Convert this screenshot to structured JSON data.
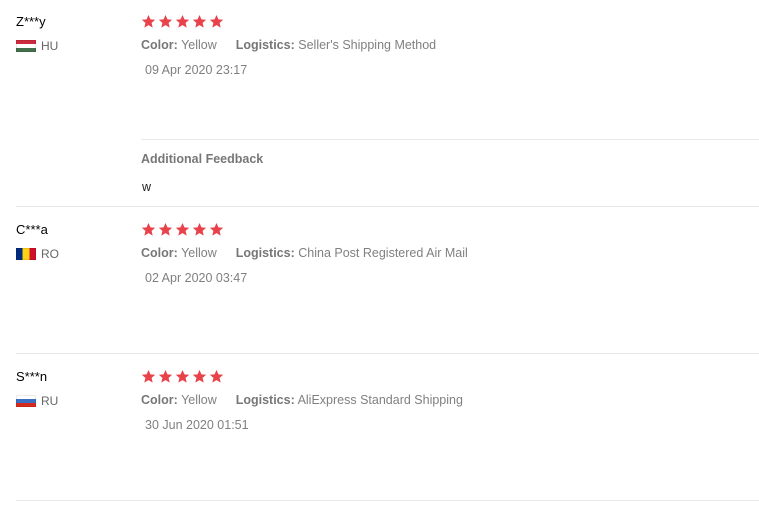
{
  "labels": {
    "color": "Color:",
    "logistics": "Logistics:",
    "additional_feedback": "Additional Feedback"
  },
  "colors": {
    "star": "#e8424a",
    "text_muted": "#808080"
  },
  "reviews": [
    {
      "user": "Z***y",
      "country": "HU",
      "flag_icon": "hungary-flag-icon",
      "rating": 5,
      "color_value": "Yellow",
      "logistics_value": "Seller's Shipping Method",
      "date": "09 Apr 2020 23:17",
      "additional_feedback": "w"
    },
    {
      "user": "C***a",
      "country": "RO",
      "flag_icon": "romania-flag-icon",
      "rating": 5,
      "color_value": "Yellow",
      "logistics_value": "China Post Registered Air Mail",
      "date": "02 Apr 2020 03:47"
    },
    {
      "user": "S***n",
      "country": "RU",
      "flag_icon": "russia-flag-icon",
      "rating": 5,
      "color_value": "Yellow",
      "logistics_value": "AliExpress Standard Shipping",
      "date": "30 Jun 2020 01:51"
    }
  ]
}
